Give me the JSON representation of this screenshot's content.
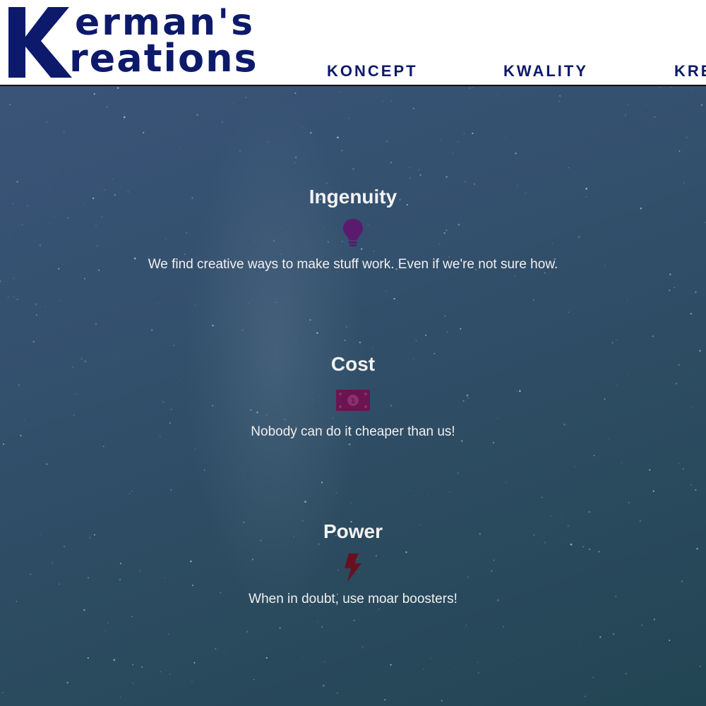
{
  "brand": {
    "line1": "erman's",
    "line2": "reations",
    "color": "#0d1a6b"
  },
  "nav": {
    "items": [
      {
        "label": "KONCEPT"
      },
      {
        "label": "KWALITY"
      },
      {
        "label": "KRE"
      }
    ]
  },
  "features": [
    {
      "title": "Ingenuity",
      "icon": "lightbulb-icon",
      "icon_color": "#5a1a6e",
      "text": "We find creative ways to make stuff work. Even if we're not sure how."
    },
    {
      "title": "Cost",
      "icon": "money-bill-icon",
      "icon_color": "#6a1450",
      "text": "Nobody can do it cheaper than us!"
    },
    {
      "title": "Power",
      "icon": "lightning-bolt-icon",
      "icon_color": "#6a0f1e",
      "text": "When in doubt, use moar boosters!"
    }
  ]
}
